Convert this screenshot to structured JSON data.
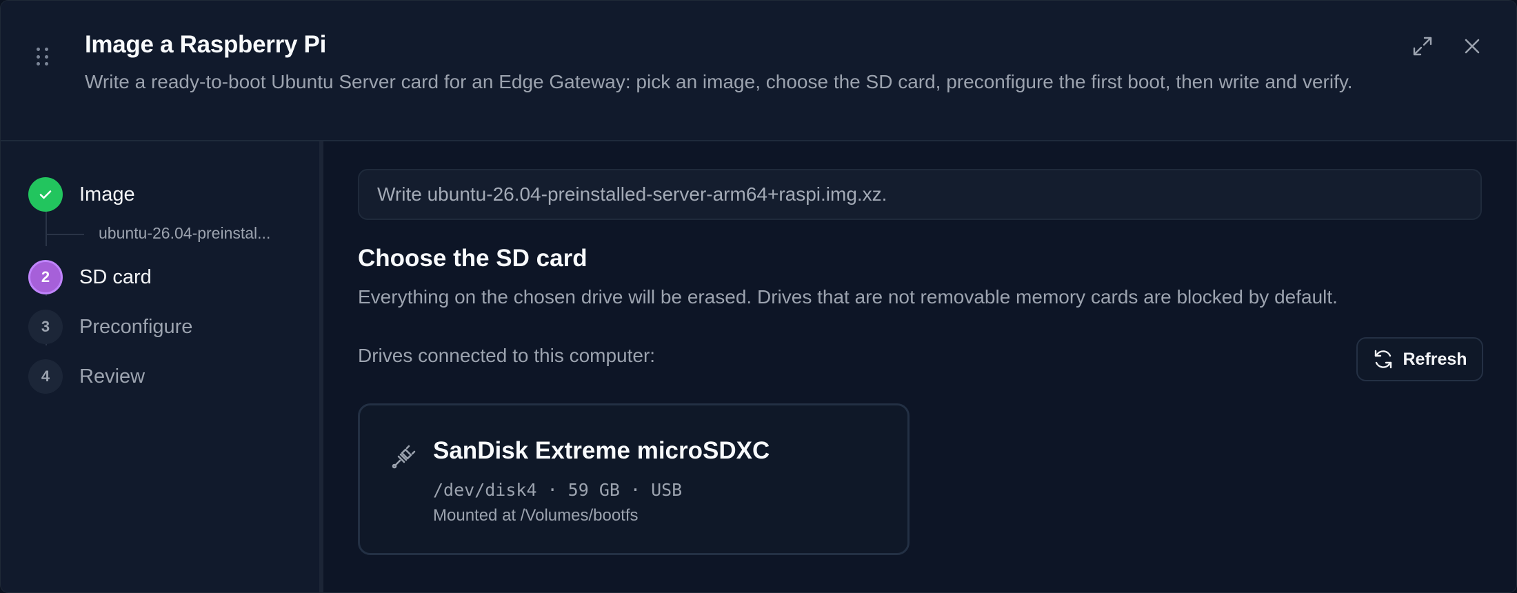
{
  "header": {
    "title": "Image a Raspberry Pi",
    "subtitle": "Write a ready-to-boot Ubuntu Server card for an Edge Gateway: pick an image, choose the SD card, preconfigure the first boot, then write and verify.",
    "icons": {
      "drag": "drag-handle-icon",
      "expand": "expand-icon",
      "close": "close-icon"
    }
  },
  "steps": [
    {
      "number": "",
      "label": "Image",
      "state": "complete",
      "detail": "ubuntu-26.04-preinstal..."
    },
    {
      "number": "2",
      "label": "SD card",
      "state": "active"
    },
    {
      "number": "3",
      "label": "Preconfigure",
      "state": "pending"
    },
    {
      "number": "4",
      "label": "Review",
      "state": "pending"
    }
  ],
  "main": {
    "notice": "Write ubuntu-26.04-preinstalled-server-arm64+raspi.img.xz.",
    "section_title": "Choose the SD card",
    "section_desc": "Everything on the chosen drive will be erased. Drives that are not removable memory cards are blocked by default.",
    "drives_label": "Drives connected to this computer:",
    "refresh_label": "Refresh",
    "drives": [
      {
        "name": "SanDisk Extreme microSDXC",
        "meta": "/dev/disk4 · 59 GB · USB",
        "mount": "Mounted at /Volumes/bootfs",
        "icon": "usb-plug-icon"
      }
    ]
  },
  "colors": {
    "accent_active": "#a660d9",
    "success": "#22c55e",
    "background": "#0d1526",
    "panel": "#111a2c"
  }
}
